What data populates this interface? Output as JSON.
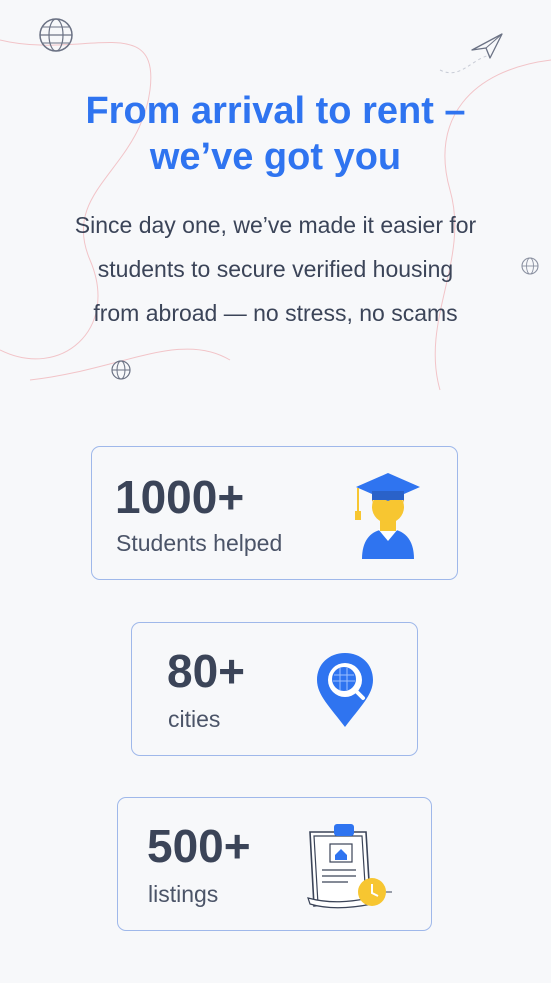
{
  "hero": {
    "title_line1": "From arrival to rent –",
    "title_line2": "we’ve got you",
    "subtitle_line1": "Since day one, we’ve made it easier for",
    "subtitle_line2": "students to secure verified housing",
    "subtitle_line3": "from abroad — no stress, no scams"
  },
  "stats": [
    {
      "value": "1000+",
      "label": "Students helped",
      "icon": "graduate-icon"
    },
    {
      "value": "80+",
      "label": "cities",
      "icon": "location-pin-icon"
    },
    {
      "value": "500+",
      "label": "listings",
      "icon": "clipboard-listing-icon"
    }
  ],
  "colors": {
    "accent": "#2f74f0",
    "text_dark": "#3b4458",
    "card_border": "#9fb8ea",
    "background": "#f7f8fa",
    "icon_yellow": "#f7c631"
  }
}
